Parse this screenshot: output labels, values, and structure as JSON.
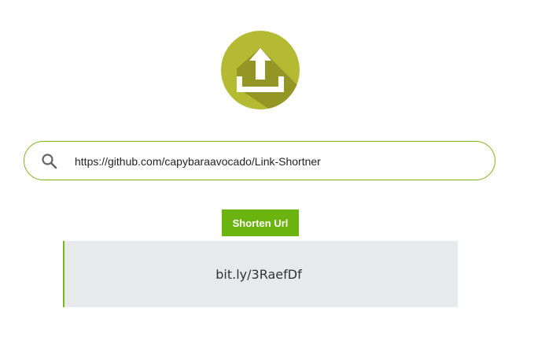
{
  "logo": {
    "icon": "upload-icon",
    "color": "#b5ba33"
  },
  "search": {
    "icon": "search-icon",
    "value": "https://github.com/capybaraavocado/Link-Shortner",
    "border_color": "#7cb518"
  },
  "button": {
    "label": "Shorten Url",
    "color": "#6bb30f"
  },
  "result": {
    "short_url": "bit.ly/3RaefDf",
    "background": "#e8e9eb",
    "accent": "#7cb518"
  }
}
